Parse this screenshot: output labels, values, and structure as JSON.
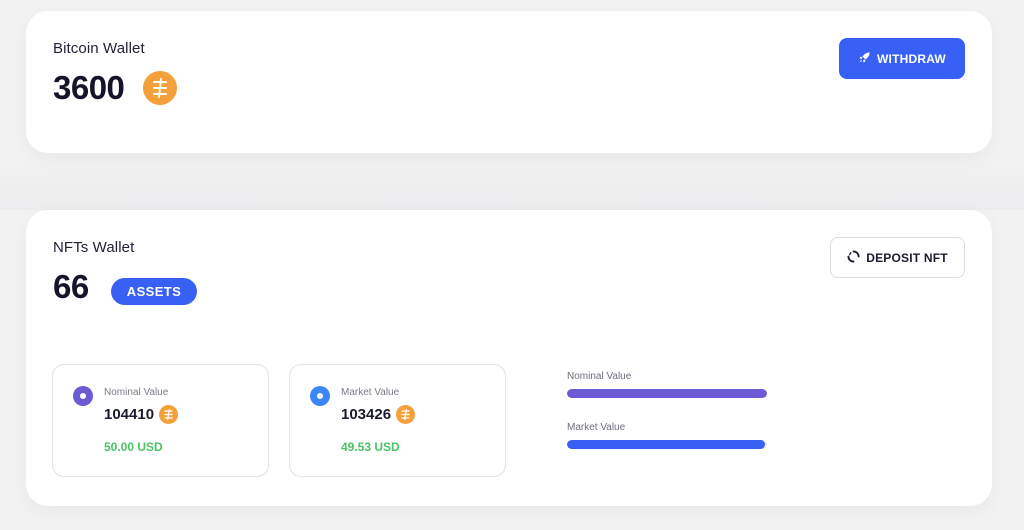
{
  "bitcoin_wallet": {
    "title": "Bitcoin Wallet",
    "amount": "3600",
    "coin_icon": "coin-icon",
    "withdraw_label": "WITHDRAW",
    "withdraw_icon": "rocket-icon"
  },
  "nfts_wallet": {
    "title": "NFTs Wallet",
    "count": "66",
    "assets_badge": "ASSETS",
    "deposit_label": "DEPOSIT NFT",
    "deposit_icon": "spinner-icon",
    "nominal": {
      "label": "Nominal Value",
      "amount": "104410",
      "usd": "50.00 USD"
    },
    "market": {
      "label": "Market Value",
      "amount": "103426",
      "usd": "49.53 USD"
    },
    "bars": {
      "nominal_label": "Nominal Value",
      "nominal_fill": 1.0,
      "market_label": "Market Value",
      "market_fill": 0.99
    }
  },
  "colors": {
    "accent_blue": "#3860f5",
    "purple": "#6b5bd5",
    "coin_orange": "#f4a03b",
    "usd_green": "#48c463"
  }
}
